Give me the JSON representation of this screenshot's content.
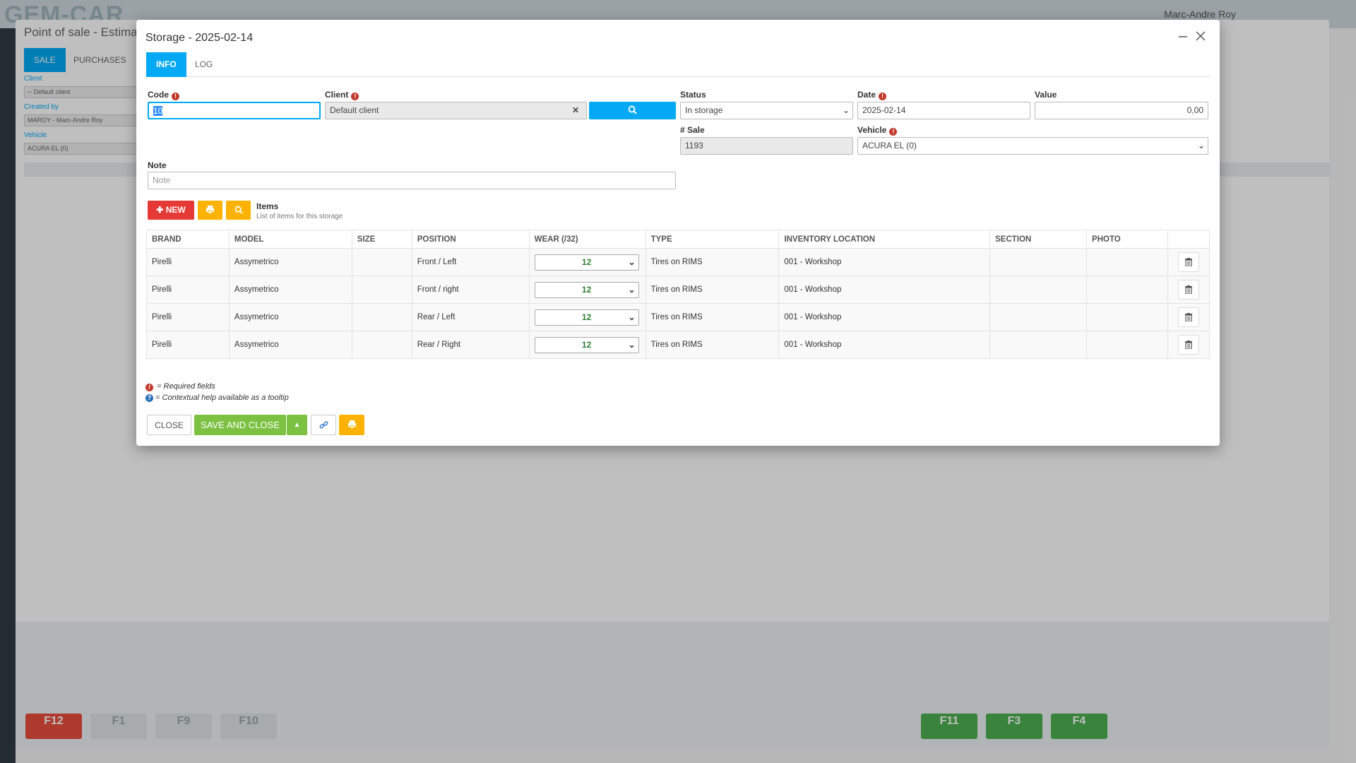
{
  "modal": {
    "title": "Storage - 2025-02-14",
    "tabs": [
      {
        "label": "INFO"
      },
      {
        "label": "LOG"
      }
    ],
    "code": {
      "label": "Code",
      "value": "10"
    },
    "client": {
      "label": "Client",
      "value": "Default client"
    },
    "status": {
      "label": "Status",
      "value": "In storage"
    },
    "date": {
      "label": "Date",
      "value": "2025-02-14"
    },
    "value": {
      "label": "Value",
      "value": "0,00"
    },
    "sale": {
      "label": "# Sale",
      "value": "1193"
    },
    "vehicle": {
      "label": "Vehicle",
      "value": "ACURA EL (0)"
    },
    "note": {
      "label": "Note",
      "placeholder": "Note"
    },
    "items": {
      "new_label": "NEW",
      "title": "Items",
      "subtitle": "List of items for this storage",
      "columns": [
        "BRAND",
        "MODEL",
        "SIZE",
        "POSITION",
        "WEAR (/32)",
        "TYPE",
        "INVENTORY LOCATION",
        "SECTION",
        "PHOTO",
        ""
      ],
      "rows": [
        {
          "brand": "Pirelli",
          "model": "Assymetrico",
          "size": "",
          "position": "Front / Left",
          "wear": "12",
          "type": "Tires on RIMS",
          "location": "001 - Workshop",
          "section": "",
          "photo": ""
        },
        {
          "brand": "Pirelli",
          "model": "Assymetrico",
          "size": "",
          "position": "Front / right",
          "wear": "12",
          "type": "Tires on RIMS",
          "location": "001 - Workshop",
          "section": "",
          "photo": ""
        },
        {
          "brand": "Pirelli",
          "model": "Assymetrico",
          "size": "",
          "position": "Rear / Left",
          "wear": "12",
          "type": "Tires on RIMS",
          "location": "001 - Workshop",
          "section": "",
          "photo": ""
        },
        {
          "brand": "Pirelli",
          "model": "Assymetrico",
          "size": "",
          "position": "Rear / Right",
          "wear": "12",
          "type": "Tires on RIMS",
          "location": "001 - Workshop",
          "section": "",
          "photo": ""
        }
      ]
    },
    "legend": {
      "required": "= Required fields",
      "help": "= Contextual help available as a tooltip"
    },
    "footer": {
      "close_label": "CLOSE",
      "save_label": "SAVE AND CLOSE"
    }
  },
  "background": {
    "logo": "GEM-CAR",
    "user": "Marc-Andre Roy",
    "title": "Point of sale - Estimate",
    "tabs": [
      "SALE",
      "PURCHASES"
    ],
    "client_label": "Client",
    "client_value": "-- Default client",
    "created_by_label": "Created by",
    "created_by_value": "MAROY - Marc-Andre Roy",
    "vehicle_label": "Vehicle",
    "vehicle_value": "ACURA EL (0)",
    "fkeys": [
      "F12",
      "F1",
      "F9",
      "F10",
      "F11",
      "F3",
      "F4"
    ]
  },
  "colors": {
    "accent": "#03a9f4",
    "danger": "#e53935",
    "warning": "#ffb300",
    "success": "#7cc142"
  }
}
